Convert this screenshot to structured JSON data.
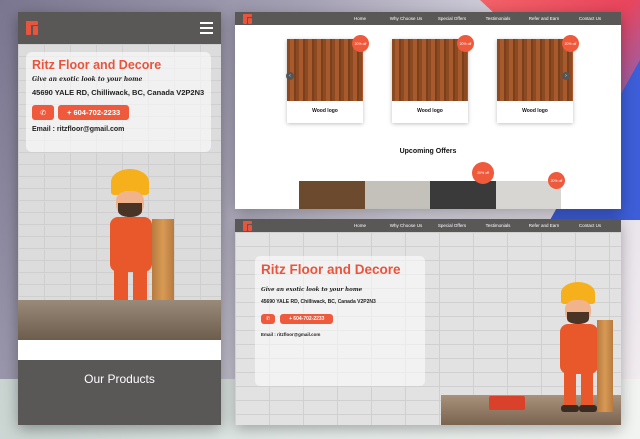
{
  "mobile": {
    "title": "Ritz Floor and Decore",
    "tagline": "Give an exotic look to your home",
    "address": "45690 YALE RD, Chilliwack, BC, Canada V2P2N3",
    "phone_icon": "phone-icon",
    "phone": "+ 604-702-2233",
    "email": "Email : ritzfloor@gmail.com",
    "products_heading": "Our Products"
  },
  "nav": {
    "links": [
      "Home",
      "Why Choose Us",
      "Special Offers",
      "Testimonials",
      "Refer and Earn",
      "Contact Us"
    ]
  },
  "products": [
    {
      "label": "Wood logo",
      "badge": "20% off"
    },
    {
      "label": "Wood logo",
      "badge": "20% off"
    },
    {
      "label": "Wood logo",
      "badge": "20% off"
    }
  ],
  "upcoming_offers": {
    "heading": "Upcoming Offers",
    "badge1": "20% off",
    "badge2": "20% off"
  },
  "desktop_hero": {
    "title": "Ritz Floor and Decore",
    "tagline": "Give an exotic look to your home",
    "address": "45690 YALE RD, Chilliwack, BC, Canada V2P2N3",
    "phone": "+ 604-702-2233",
    "email": "Email : ritzfloor@gmail.com"
  },
  "colors": {
    "accent": "#f05a3c",
    "nav": "#5a5757"
  }
}
